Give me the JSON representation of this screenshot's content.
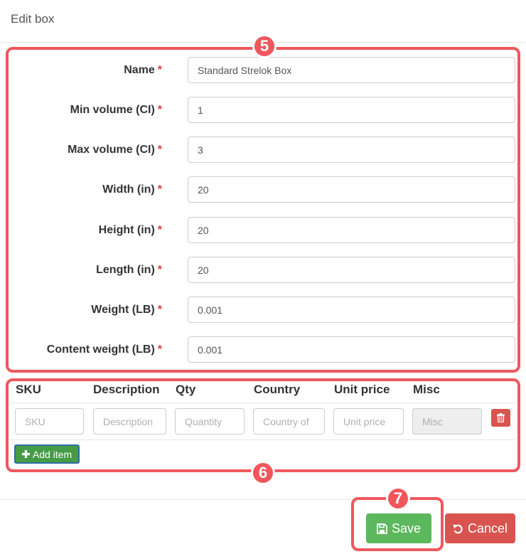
{
  "dialog": {
    "title": "Edit box"
  },
  "fields": [
    {
      "label": "Name",
      "value": "Standard Strelok Box"
    },
    {
      "label": "Min volume (CI)",
      "value": "1"
    },
    {
      "label": "Max volume (CI)",
      "value": "3"
    },
    {
      "label": "Width (in)",
      "value": "20"
    },
    {
      "label": "Height (in)",
      "value": "20"
    },
    {
      "label": "Length (in)",
      "value": "20"
    },
    {
      "label": "Weight (LB)",
      "value": "0.001"
    },
    {
      "label": "Content weight (LB)",
      "value": "0.001"
    }
  ],
  "required_marker": "*",
  "items_table": {
    "headers": [
      "SKU",
      "Description",
      "Qty",
      "Country",
      "Unit price",
      "Misc"
    ],
    "placeholders": [
      "SKU",
      "Description",
      "Quantity",
      "Country of",
      "Unit price",
      "Misc"
    ],
    "add_label": "Add item"
  },
  "footer": {
    "save_label": "Save",
    "cancel_label": "Cancel"
  },
  "annotations": [
    "5",
    "6",
    "7"
  ],
  "colors": {
    "annotation": "#f0575c",
    "save": "#5cb85c",
    "cancel": "#d9534f",
    "add": "#449d44"
  }
}
